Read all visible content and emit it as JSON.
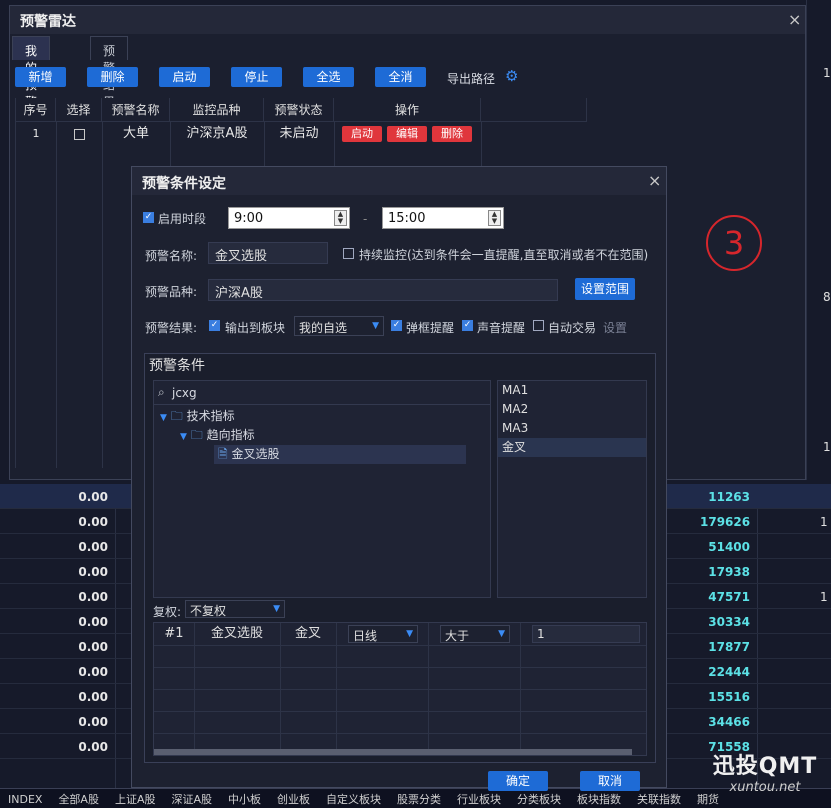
{
  "background": {
    "right_values": [
      "1",
      "8",
      "1"
    ],
    "zeros": [
      "0.00",
      "0.00",
      "0.00",
      "0.00",
      "0.00",
      "0.00",
      "0.00",
      "0.00",
      "0.00",
      "0.00",
      "0.00"
    ],
    "cyan_values": [
      "11263",
      "179626",
      "51400",
      "17938",
      "47571",
      "30334",
      "17877",
      "22444",
      "15516",
      "34466",
      "71558"
    ],
    "right_row_values": [
      "1",
      "1"
    ],
    "bottom_bar": [
      "INDEX",
      "全部A股",
      "上证A股",
      "深证A股",
      "中小板",
      "创业板",
      "自定义板块",
      "股票分类",
      "行业板块",
      "分类板块",
      "板块指数",
      "关联指数",
      "期货"
    ]
  },
  "watermark": {
    "line1": "迅投QMT",
    "line2": "xuntou.net"
  },
  "radar": {
    "title": "预警雷达",
    "close": "×",
    "tabs": [
      "我的预警",
      "预警结果"
    ],
    "toolbar": [
      "新增",
      "删除",
      "启动",
      "停止",
      "全选",
      "全消"
    ],
    "export_label": "导出路径",
    "gear_icon": "⚙",
    "columns": [
      "序号",
      "选择",
      "预警名称",
      "监控品种",
      "预警状态",
      "操作"
    ],
    "row": {
      "index": "1",
      "name": "大单",
      "variety": "沪深京A股",
      "status": "未启动",
      "actions": [
        "启动",
        "编辑",
        "删除"
      ]
    }
  },
  "annotation": "3",
  "condition": {
    "title": "预警条件设定",
    "close": "×",
    "enable_time_label": "启用时段",
    "time_start": "9:00",
    "time_sep": "-",
    "time_end": "15:00",
    "name_label": "预警名称:",
    "name_value": "金叉选股",
    "continuous_label": "持续监控(达到条件会一直提醒,直至取消或者不在范围)",
    "variety_label": "预警品种:",
    "variety_value": "沪深A股",
    "set_range_btn": "设置范围",
    "result_label": "预警结果:",
    "output_label": "输出到板块",
    "output_select": "我的自选",
    "popup_label": "弹框提醒",
    "sound_label": "声音提醒",
    "auto_trade_label": "自动交易",
    "settings_link": "设置",
    "section_title": "预警条件",
    "search_value": "jcxg",
    "tree": [
      "技术指标",
      "趋向指标",
      "金叉选股"
    ],
    "list": [
      "MA1",
      "MA2",
      "MA3",
      "金叉"
    ],
    "adjust_label": "复权:",
    "adjust_value": "不复权",
    "grid_row": {
      "idx": "#1",
      "name": "金叉选股",
      "signal": "金叉",
      "period": "日线",
      "compare": "大于",
      "value": "1"
    },
    "ok_btn": "确定",
    "cancel_btn": "取消"
  }
}
